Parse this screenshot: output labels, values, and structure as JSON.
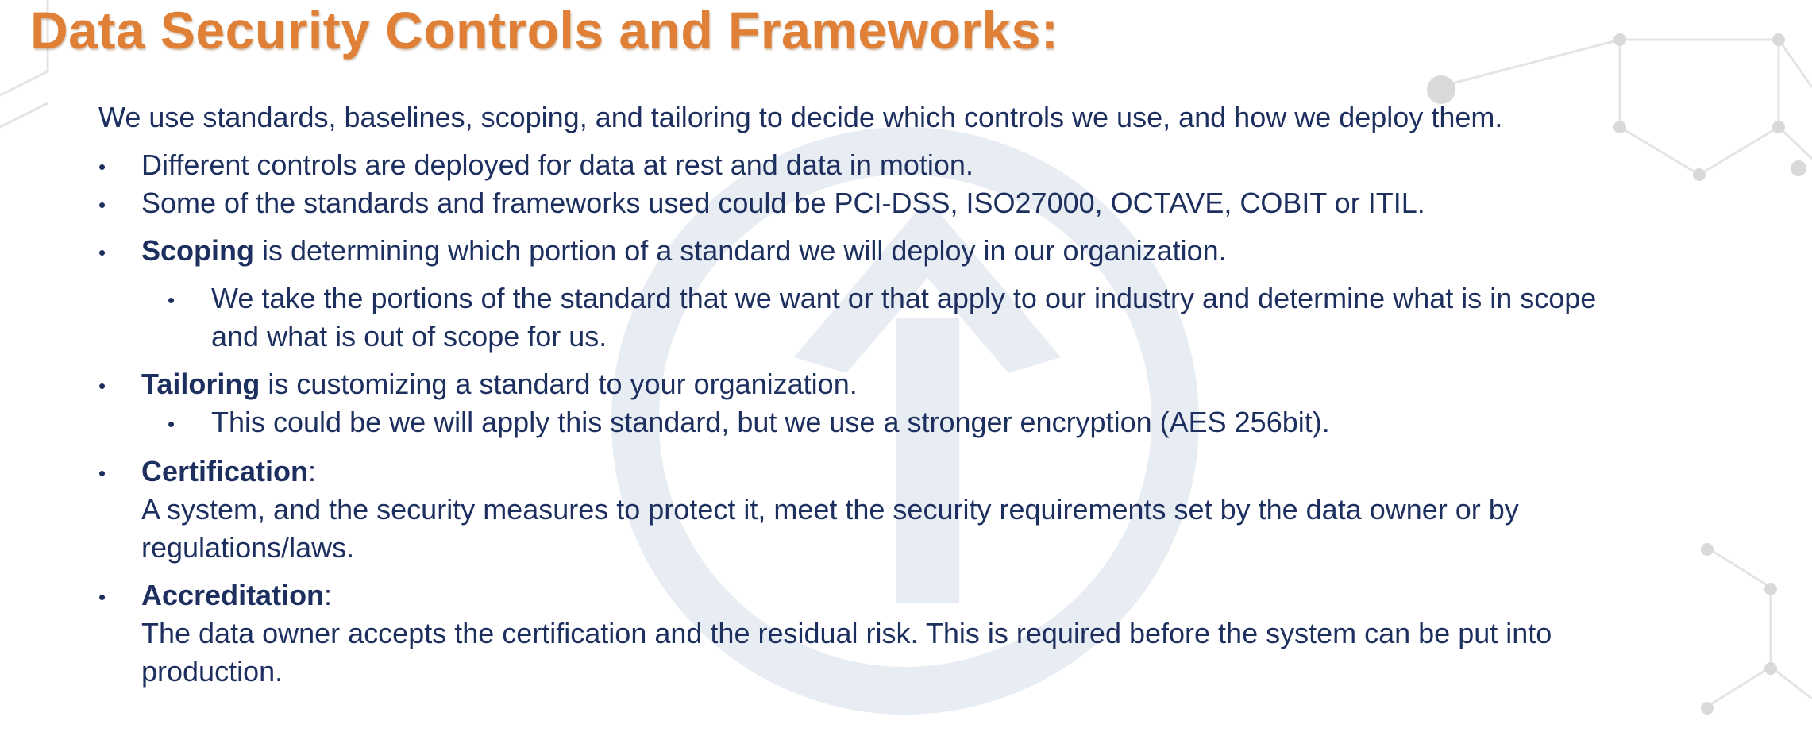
{
  "slide": {
    "title": "Data Security Controls and Frameworks:",
    "intro": "We use standards, baselines, scoping, and tailoring to decide which controls we use, and how we deploy them.",
    "bullet_char": "•",
    "bullets": [
      {
        "text": "Different controls are deployed for data at rest and data in motion."
      },
      {
        "text": "Some of the standards and frameworks used could be PCI-DSS, ISO27000, OCTAVE, COBIT or ITIL."
      },
      {
        "term": "Scoping",
        "text": " is determining which portion of a standard we will deploy in our organization.",
        "sub": {
          "line1": "We take the portions of the standard that we want or that apply to our industry and determine what is in scope",
          "line2": "and what is out of scope for us."
        }
      },
      {
        "term": "Tailoring",
        "text": " is customizing a standard to your organization.",
        "sub": {
          "line1": "This could be we will apply this standard, but we use a stronger encryption (AES 256bit)."
        }
      },
      {
        "term": "Certification",
        "text": ":",
        "line2": "A system, and the security measures to protect it, meet the security requirements set by the data owner or by",
        "line3": "regulations/laws."
      },
      {
        "term": "Accreditation",
        "text": ":",
        "line2": "The data owner accepts the certification and the residual risk. This is required before the system can be put into",
        "line3": "production."
      }
    ]
  },
  "colors": {
    "title": "#e07f36",
    "body_text": "#1d2f5f",
    "watermark": "#e8ecf3",
    "network_lines": "#e2e2e2"
  },
  "icons": {
    "watermark": "upward-arrow-in-circle",
    "background": "network-node-lines"
  }
}
